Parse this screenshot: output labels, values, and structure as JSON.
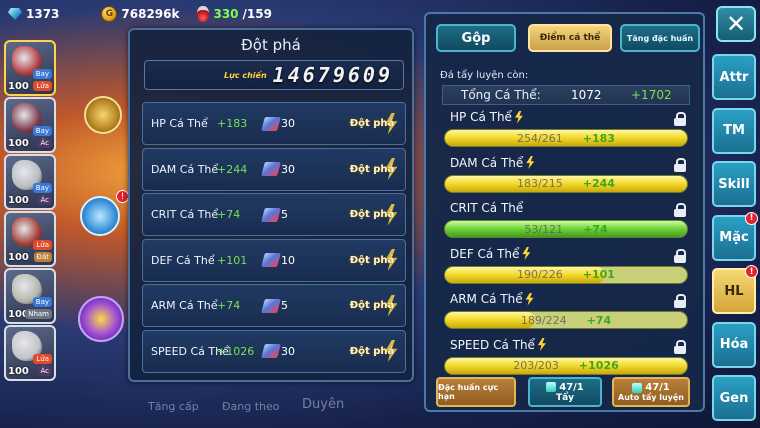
{
  "topbar": {
    "gems": "1373",
    "gold": "768296k",
    "energy_current": "330",
    "energy_max": "/159"
  },
  "heroes": [
    {
      "level": "100",
      "tags": [
        "Bay",
        "Lửa"
      ],
      "color": "#c63a3a"
    },
    {
      "level": "100",
      "tags": [
        "Bay",
        "Ác"
      ],
      "color": "#8a3a4a"
    },
    {
      "level": "100",
      "tags": [
        "Bay",
        "Ác"
      ],
      "color": "#cfcfcf"
    },
    {
      "level": "100",
      "tags": [
        "Lửa",
        "Đất"
      ],
      "color": "#b33a2a"
    },
    {
      "level": "100",
      "tags": [
        "Bay",
        "Nham"
      ],
      "color": "#c9c9b5"
    },
    {
      "level": "100",
      "tags": [
        "Lửa",
        "Ác"
      ],
      "color": "#d8d8d8"
    }
  ],
  "breakthrough": {
    "title": "Đột phá",
    "cp_label": "Lực chiến",
    "cp_value": "14679609",
    "button_label": "Đột phá",
    "rows": [
      {
        "name": "HP Cá Thể",
        "bonus": "+183",
        "cost": "30"
      },
      {
        "name": "DAM Cá Thể",
        "bonus": "+244",
        "cost": "30"
      },
      {
        "name": "CRIT Cá Thể",
        "bonus": "+74",
        "cost": "5"
      },
      {
        "name": "DEF Cá Thể",
        "bonus": "+101",
        "cost": "10"
      },
      {
        "name": "ARM Cá Thể",
        "bonus": "+74",
        "cost": "5"
      },
      {
        "name": "SPEED Cá Thể",
        "bonus": "+1026",
        "cost": "30"
      }
    ]
  },
  "faded_tabs": [
    "Tăng cấp",
    "Đang theo",
    "Duyên"
  ],
  "right_panel": {
    "tabs": {
      "gop": "Gộp",
      "diem": "Điểm cá thể",
      "tang": "Tăng đặc huấn"
    },
    "remain_label": "Đá tẩy luyện còn:",
    "total": {
      "label": "Tổng Cá Thể:",
      "value": "1072",
      "bonus": "+1702"
    },
    "stats": [
      {
        "name": "HP Cá Thể",
        "value": "254/261",
        "bonus": "+183",
        "fill": 1.0,
        "color": "yellow",
        "bolt": true
      },
      {
        "name": "DAM Cá Thể",
        "value": "183/215",
        "bonus": "+244",
        "fill": 1.0,
        "color": "yellow",
        "bolt": true
      },
      {
        "name": "CRIT Cá Thể",
        "value": "53/121",
        "bonus": "+74",
        "fill": 1.0,
        "color": "green",
        "bolt": false
      },
      {
        "name": "DEF Cá Thể",
        "value": "190/226",
        "bonus": "+101",
        "fill": 0.66,
        "color": "yellow",
        "bolt": true
      },
      {
        "name": "ARM Cá Thể",
        "value": "189/224",
        "bonus": "+74",
        "fill": 0.37,
        "color": "yellow",
        "bolt": true
      },
      {
        "name": "SPEED Cá Thể",
        "value": "203/203",
        "bonus": "+1026",
        "fill": 1.0,
        "color": "yellow",
        "bolt": true
      }
    ],
    "buttons": {
      "dac_huan": "Đặc huấn cực hạn",
      "tay_count": "47/1",
      "tay_label": "Tẩy",
      "auto_count": "47/1",
      "auto_label": "Auto tẩy luyện"
    }
  },
  "side_nav": {
    "close": "✕",
    "tabs": [
      {
        "label": "Attr",
        "badge": ""
      },
      {
        "label": "TM",
        "badge": ""
      },
      {
        "label": "Skill",
        "badge": ""
      },
      {
        "label": "Mặc",
        "badge": "!"
      },
      {
        "label": "HL",
        "badge": "!",
        "active": true
      },
      {
        "label": "Hóa",
        "badge": ""
      },
      {
        "label": "Gen",
        "badge": ""
      }
    ]
  }
}
